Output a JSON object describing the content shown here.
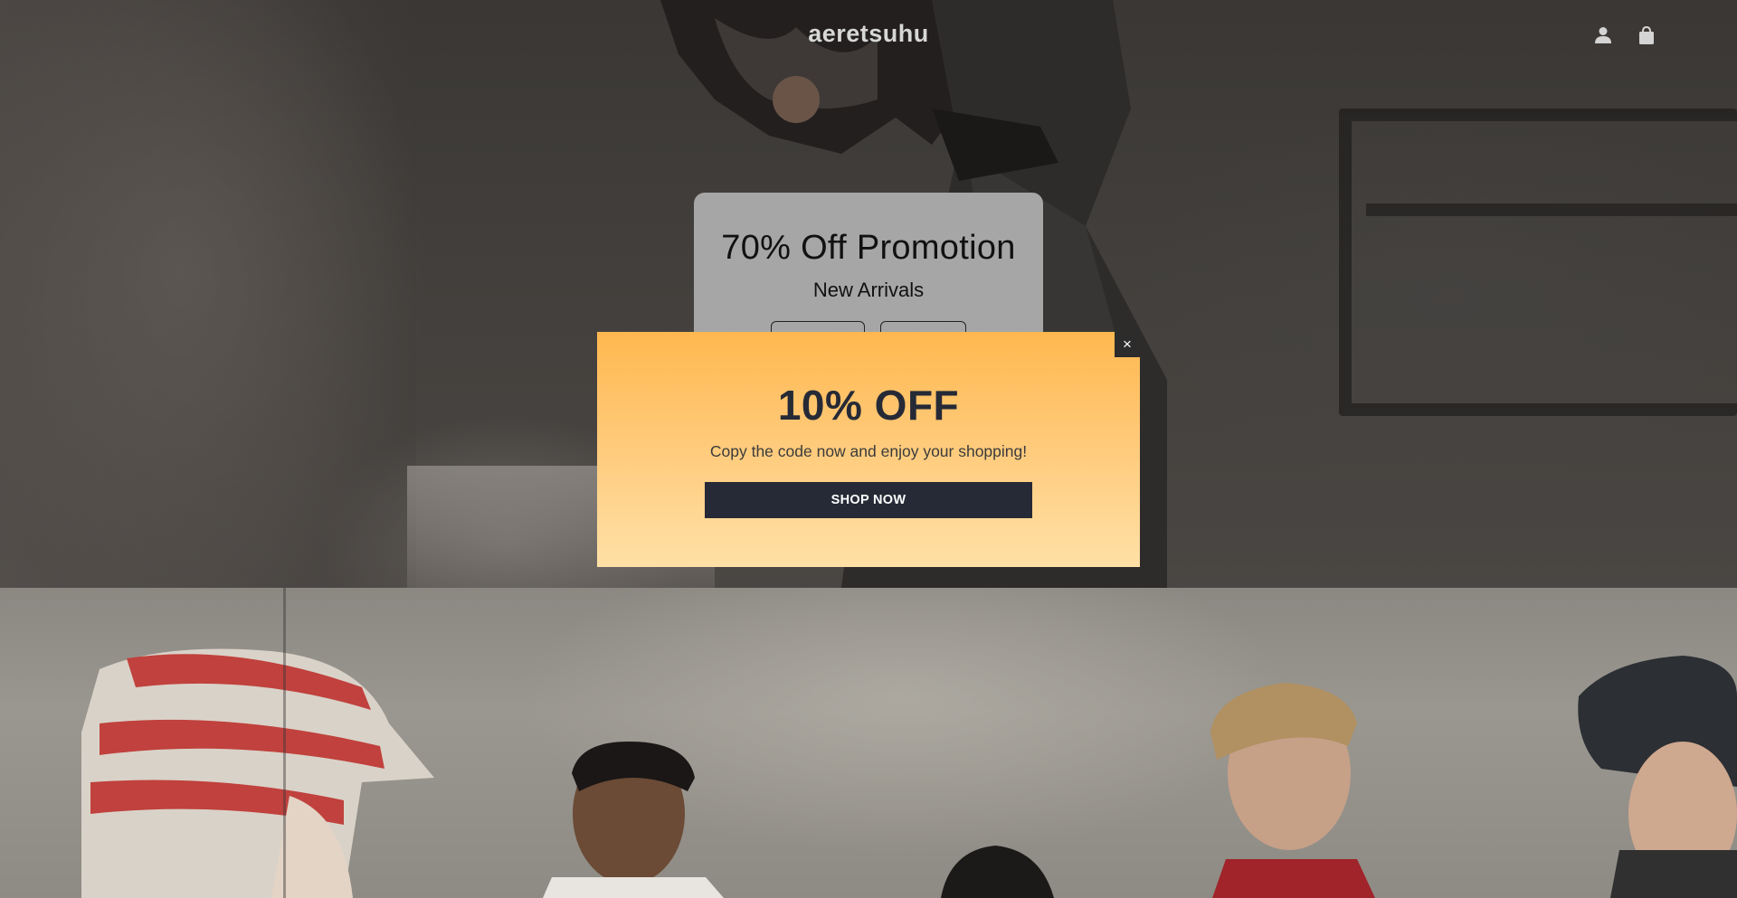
{
  "header": {
    "logo": "aeretsuhu",
    "icons": [
      "account-icon",
      "cart-icon"
    ]
  },
  "promo_card": {
    "title": "70% Off Promotion",
    "subtitle": "New Arrivals",
    "background": "#a6a6a6"
  },
  "popup": {
    "close_label": "×",
    "heading": "10% OFF",
    "text": "Copy the code now and enjoy your shopping!",
    "button_label": "SHOP NOW",
    "gradient_top": "#ffb84f",
    "gradient_bottom": "#ffe0a6",
    "button_color": "#262a36"
  }
}
